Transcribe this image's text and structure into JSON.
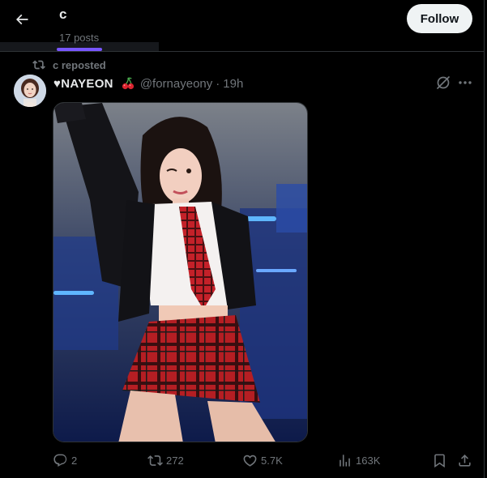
{
  "header": {
    "title": "c",
    "post_count": "17 posts",
    "follow_label": "Follow"
  },
  "repost": {
    "label": "c reposted"
  },
  "tweet": {
    "display_name": "♥NAYEON",
    "emoji": "🍒",
    "handle": "@fornayeony",
    "separator": "·",
    "time": "19h"
  },
  "actions": {
    "replies": "2",
    "reposts": "272",
    "likes": "5.7K",
    "views": "163K"
  },
  "colors": {
    "accent": "#1d9bf0",
    "tab_indicator": "#7856ff",
    "muted": "#71767b",
    "follow_bg": "#eff3f4"
  },
  "icons": [
    "back-arrow-icon",
    "repost-icon",
    "grok-icon",
    "more-icon",
    "reply-icon",
    "like-icon",
    "views-icon",
    "bookmark-icon",
    "share-icon"
  ]
}
